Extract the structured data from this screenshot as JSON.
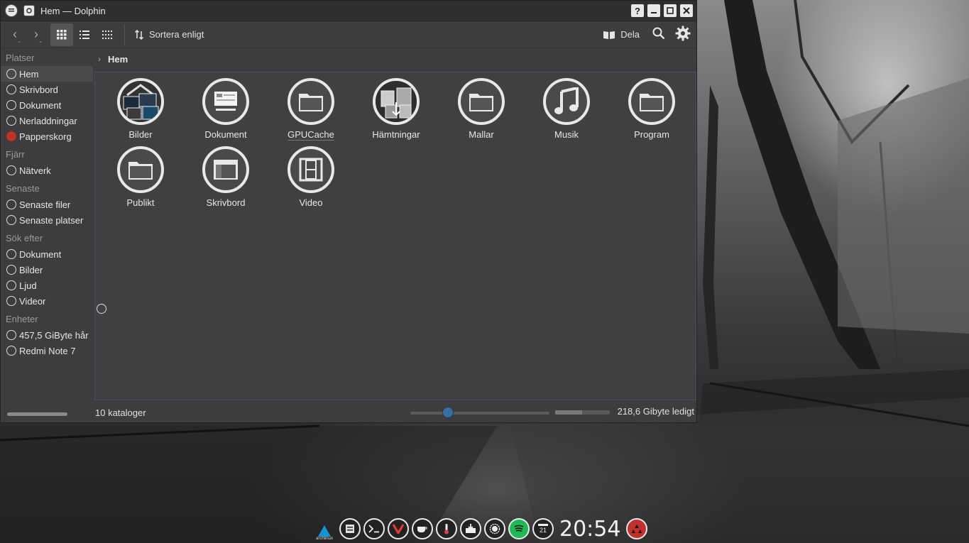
{
  "window": {
    "title": "Hem — Dolphin",
    "help_label": "?",
    "minimize_label": "_",
    "maximize_label": "□",
    "close_label": "✕"
  },
  "toolbar": {
    "sort_label": "Sortera enligt",
    "share_label": "Dela"
  },
  "sidebar": {
    "sections": [
      {
        "title": "Platser",
        "items": [
          {
            "label": "Hem",
            "icon": "home-icon",
            "active": true
          },
          {
            "label": "Skrivbord",
            "icon": "desktop-icon"
          },
          {
            "label": "Dokument",
            "icon": "document-icon"
          },
          {
            "label": "Nerladdningar",
            "icon": "download-icon"
          },
          {
            "label": "Papperskorg",
            "icon": "trash-icon"
          }
        ]
      },
      {
        "title": "Fjärr",
        "items": [
          {
            "label": "Nätverk",
            "icon": "network-icon"
          }
        ]
      },
      {
        "title": "Senaste",
        "items": [
          {
            "label": "Senaste filer",
            "icon": "recent-files-icon"
          },
          {
            "label": "Senaste platser",
            "icon": "recent-places-icon"
          }
        ]
      },
      {
        "title": "Sök efter",
        "items": [
          {
            "label": "Dokument",
            "icon": "document-icon"
          },
          {
            "label": "Bilder",
            "icon": "image-icon"
          },
          {
            "label": "Ljud",
            "icon": "audio-icon"
          },
          {
            "label": "Videor",
            "icon": "video-icon"
          }
        ]
      },
      {
        "title": "Enheter",
        "items": [
          {
            "label": "457,5 GiByte hår",
            "icon": "harddisk-icon"
          },
          {
            "label": "Redmi  Note  7",
            "icon": "phone-icon"
          }
        ]
      }
    ]
  },
  "breadcrumb": {
    "current": "Hem"
  },
  "folders": [
    {
      "label": "Bilder",
      "icon": "pictures-folder-icon"
    },
    {
      "label": "Dokument",
      "icon": "documents-folder-icon"
    },
    {
      "label": "GPUCache",
      "icon": "folder-icon"
    },
    {
      "label": "Hämtningar",
      "icon": "downloads-folder-icon"
    },
    {
      "label": "Mallar",
      "icon": "folder-icon"
    },
    {
      "label": "Musik",
      "icon": "music-folder-icon"
    },
    {
      "label": "Program",
      "icon": "folder-icon"
    },
    {
      "label": "Publikt",
      "icon": "folder-icon"
    },
    {
      "label": "Skrivbord",
      "icon": "desktop-folder-icon"
    },
    {
      "label": "Video",
      "icon": "video-folder-icon"
    }
  ],
  "status": {
    "count_text": "10 kataloger",
    "free_text": "218,6 Gibyte ledigt",
    "zoom_level": 0.27,
    "used_fraction": 0.49
  },
  "taskbar": {
    "clock": "20:54",
    "arch_text": "archlinux",
    "icons": [
      "file-manager-icon",
      "terminal-icon",
      "vivaldi-icon",
      "caffeine-icon",
      "temperature-icon",
      "installer-icon",
      "signal-icon",
      "spotify-icon",
      "calendar-icon"
    ],
    "calendar_day": "21"
  },
  "colors": {
    "accent": "#3b6ea0",
    "trash_red": "#c0312b",
    "arch_blue": "#1793d1",
    "spotify_green": "#1db954",
    "vivaldi_red": "#ef3939"
  }
}
